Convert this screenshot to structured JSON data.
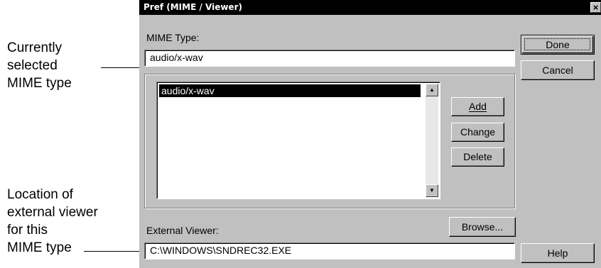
{
  "annotations": {
    "mime_type_callout": [
      "Currently",
      "selected",
      "MIME type"
    ],
    "viewer_callout": [
      "Location of",
      "external viewer",
      "for this",
      "MIME type"
    ]
  },
  "dialog": {
    "title": "Pref (MIME / Viewer)",
    "close_glyph": "×",
    "mime_type_label": "MIME Type:",
    "mime_type_value": "audio/x-wav",
    "list_items": [
      "audio/x-wav"
    ],
    "scroll_up_glyph": "▲",
    "scroll_down_glyph": "▼",
    "buttons": {
      "done": "Done",
      "cancel": "Cancel",
      "add": "Add",
      "change": "Change",
      "delete": "Delete",
      "browse": "Browse...",
      "help": "Help"
    },
    "external_viewer_label": "External Viewer:",
    "external_viewer_value": "C:\\WINDOWS\\SNDREC32.EXE"
  }
}
